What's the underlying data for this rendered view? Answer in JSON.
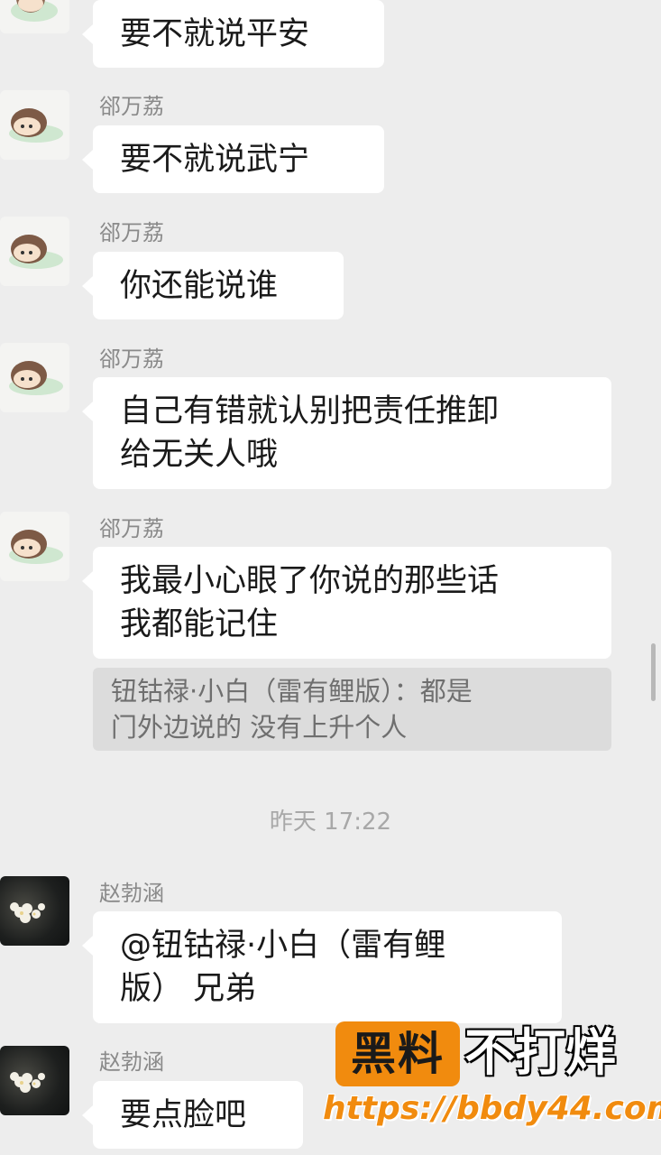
{
  "messages": [
    {
      "text": "要不就说平安"
    },
    {
      "sender": "郤万荔",
      "text": "要不就说武宁"
    },
    {
      "sender": "郤万荔",
      "text": "你还能说谁"
    },
    {
      "sender": "郤万荔",
      "line1": "自己有错就认别把责任推卸",
      "line2": "给无关人哦"
    },
    {
      "sender": "郤万荔",
      "line1": "我最小心眼了你说的那些话",
      "line2": "我都能记住"
    }
  ],
  "quote": {
    "line1": "钮钴禄·小白（雷有鲤版）：都是",
    "line2": "门外边说的 没有上升个人"
  },
  "timestamp": "昨天 17:22",
  "messages2": [
    {
      "sender": "赵勃涵",
      "line1": "@钮钴禄·小白（雷有鲤",
      "line2": "版） 兄弟"
    },
    {
      "sender": "赵勃涵",
      "text": "要点脸吧"
    }
  ],
  "watermark": {
    "badge": "黑料",
    "text": "不打烊",
    "url": "https://bbdy44.com"
  },
  "colors": {
    "background": "#ededed",
    "bubble": "#ffffff",
    "quote_bg": "#dcdcdc",
    "watermark_orange": "#f18b0e"
  }
}
